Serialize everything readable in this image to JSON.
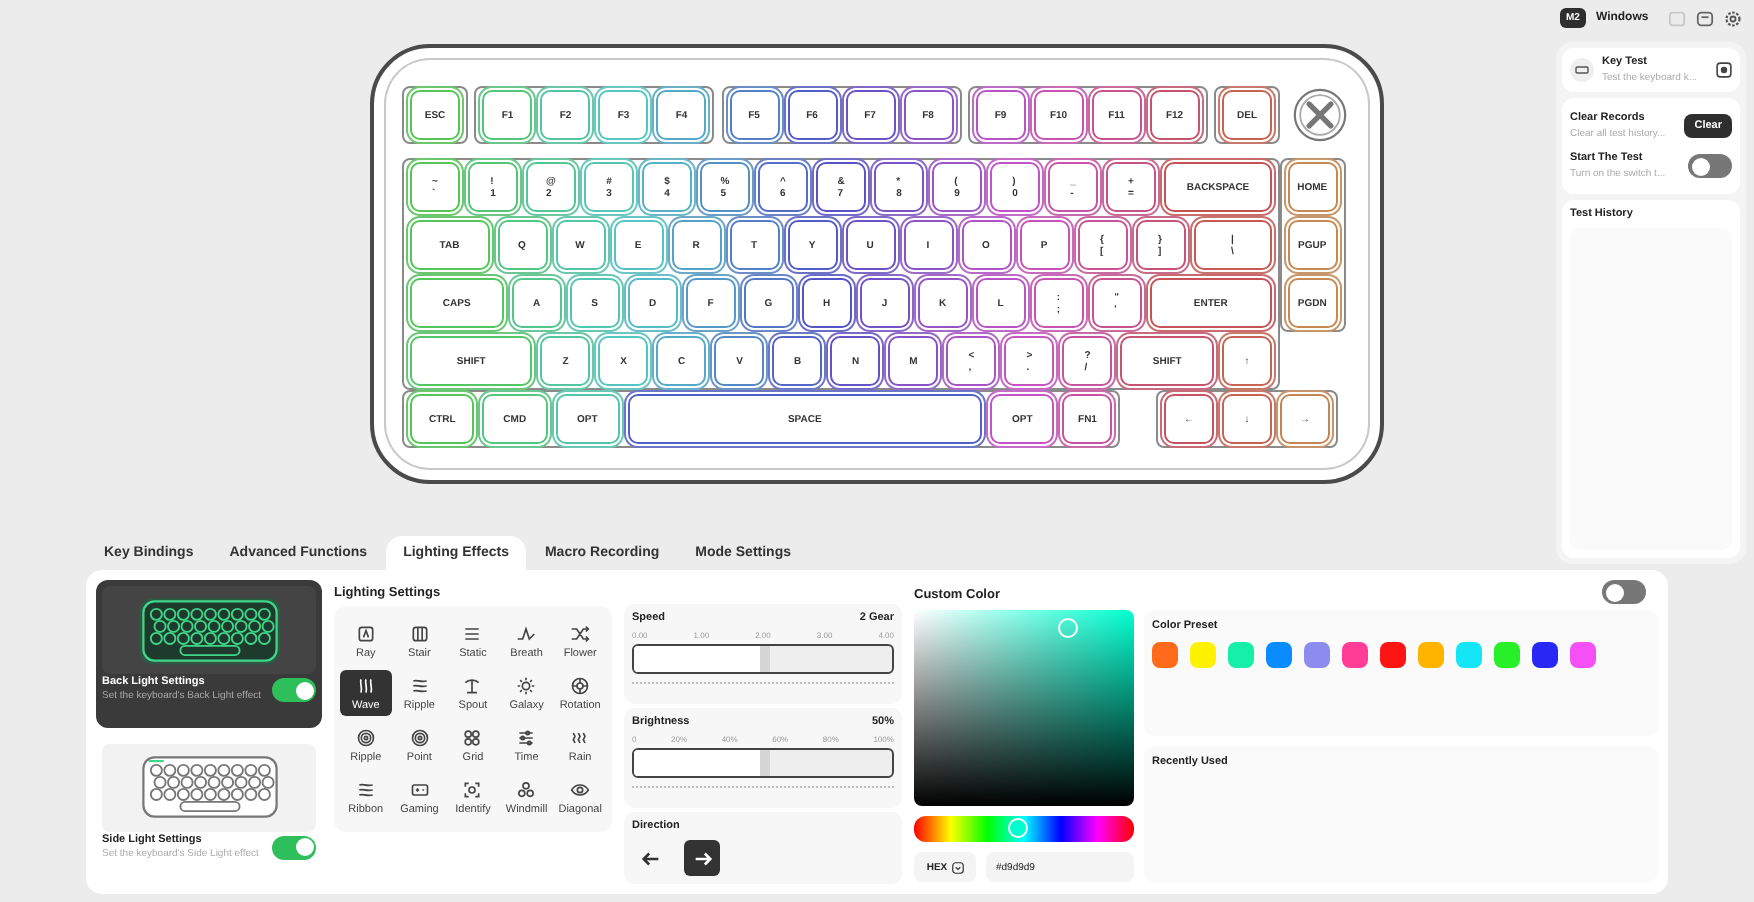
{
  "top_bar": {
    "profile": "M2",
    "os": "Windows"
  },
  "key_test": {
    "title": "Key Test",
    "description": "Test the keyboard k..."
  },
  "clear_records": {
    "title": "Clear Records",
    "description": "Clear all test history...",
    "button": "Clear"
  },
  "start_test": {
    "title": "Start The Test",
    "description": "Turn on the switch t...",
    "on": false
  },
  "test_history": {
    "title": "Test History"
  },
  "keyboard": {
    "rows": [
      [
        {
          "label": "ESC"
        },
        {
          "label": "F1"
        },
        {
          "label": "F2"
        },
        {
          "label": "F3"
        },
        {
          "label": "F4"
        },
        {
          "label": "F5"
        },
        {
          "label": "F6"
        },
        {
          "label": "F7"
        },
        {
          "label": "F8"
        },
        {
          "label": "F9"
        },
        {
          "label": "F10"
        },
        {
          "label": "F11"
        },
        {
          "label": "F12"
        },
        {
          "label": "DEL"
        }
      ],
      [
        {
          "label": "~",
          "sub": "`"
        },
        {
          "label": "!",
          "sub": "1"
        },
        {
          "label": "@",
          "sub": "2"
        },
        {
          "label": "#",
          "sub": "3"
        },
        {
          "label": "$",
          "sub": "4"
        },
        {
          "label": "%",
          "sub": "5"
        },
        {
          "label": "^",
          "sub": "6"
        },
        {
          "label": "&",
          "sub": "7"
        },
        {
          "label": "*",
          "sub": "8"
        },
        {
          "label": "(",
          "sub": "9"
        },
        {
          "label": ")",
          "sub": "0"
        },
        {
          "label": "_",
          "sub": "-"
        },
        {
          "label": "+",
          "sub": "="
        },
        {
          "label": "BACKSPACE"
        }
      ],
      [
        {
          "label": "TAB"
        },
        {
          "label": "Q"
        },
        {
          "label": "W"
        },
        {
          "label": "E"
        },
        {
          "label": "R"
        },
        {
          "label": "T"
        },
        {
          "label": "Y"
        },
        {
          "label": "U"
        },
        {
          "label": "I"
        },
        {
          "label": "O"
        },
        {
          "label": "P"
        },
        {
          "label": "{",
          "sub": "["
        },
        {
          "label": "}",
          "sub": "]"
        },
        {
          "label": "|",
          "sub": "\\"
        }
      ],
      [
        {
          "label": "CAPS"
        },
        {
          "label": "A"
        },
        {
          "label": "S"
        },
        {
          "label": "D"
        },
        {
          "label": "F"
        },
        {
          "label": "G"
        },
        {
          "label": "H"
        },
        {
          "label": "J"
        },
        {
          "label": "K"
        },
        {
          "label": "L"
        },
        {
          "label": ":",
          "sub": ";"
        },
        {
          "label": "\"",
          "sub": "'"
        },
        {
          "label": "ENTER"
        }
      ],
      [
        {
          "label": "SHIFT"
        },
        {
          "label": "Z"
        },
        {
          "label": "X"
        },
        {
          "label": "C"
        },
        {
          "label": "V"
        },
        {
          "label": "B"
        },
        {
          "label": "N"
        },
        {
          "label": "M"
        },
        {
          "label": "<",
          "sub": ","
        },
        {
          "label": ">",
          "sub": "."
        },
        {
          "label": "?",
          "sub": "/"
        },
        {
          "label": "SHIFT"
        }
      ],
      [
        {
          "label": "CTRL"
        },
        {
          "label": "CMD"
        },
        {
          "label": "OPT"
        },
        {
          "label": "SPACE"
        },
        {
          "label": "OPT"
        },
        {
          "label": "FN1"
        }
      ]
    ],
    "arrow_keys": [
      {
        "label": "↑"
      },
      {
        "label": "←"
      },
      {
        "label": "↓"
      },
      {
        "label": "→"
      }
    ],
    "nav_keys": [
      {
        "label": "HOME"
      },
      {
        "label": "PGUP"
      },
      {
        "label": "PGDN"
      }
    ]
  },
  "tabs": [
    {
      "label": "Key Bindings",
      "selected": false
    },
    {
      "label": "Advanced Functions",
      "selected": false
    },
    {
      "label": "Lighting Effects",
      "selected": true
    },
    {
      "label": "Macro Recording",
      "selected": false
    },
    {
      "label": "Mode Settings",
      "selected": false
    }
  ],
  "light_cards": [
    {
      "title": "Back Light Settings",
      "description": "Set the keyboard's Back Light effect",
      "selected": true,
      "on": true
    },
    {
      "title": "Side Light Settings",
      "description": "Set the keyboard's Side Light effect",
      "selected": false,
      "on": true
    }
  ],
  "lighting_settings": {
    "title": "Lighting Settings",
    "effects": [
      {
        "label": "Ray",
        "selected": false
      },
      {
        "label": "Stair",
        "selected": false
      },
      {
        "label": "Static",
        "selected": false
      },
      {
        "label": "Breath",
        "selected": false
      },
      {
        "label": "Flower",
        "selected": false
      },
      {
        "label": "Wave",
        "selected": true
      },
      {
        "label": "Ripple",
        "selected": false
      },
      {
        "label": "Spout",
        "selected": false
      },
      {
        "label": "Galaxy",
        "selected": false
      },
      {
        "label": "Rotation",
        "selected": false
      },
      {
        "label": "Ripple",
        "selected": false
      },
      {
        "label": "Point",
        "selected": false
      },
      {
        "label": "Grid",
        "selected": false
      },
      {
        "label": "Time",
        "selected": false
      },
      {
        "label": "Rain",
        "selected": false
      },
      {
        "label": "Ribbon",
        "selected": false
      },
      {
        "label": "Gaming",
        "selected": false
      },
      {
        "label": "Identify",
        "selected": false
      },
      {
        "label": "Windmill",
        "selected": false
      },
      {
        "label": "Diagonal",
        "selected": false
      }
    ]
  },
  "sliders": [
    {
      "label": "Speed",
      "reading": "2 Gear",
      "ticks": [
        "0.00",
        "1.00",
        "2.00",
        "3.00",
        "4.00"
      ],
      "level": 0.5
    },
    {
      "label": "Brightness",
      "reading": "50%",
      "ticks": [
        "0",
        "20%",
        "40%",
        "60%",
        "80%",
        "100%"
      ],
      "level": 0.5
    }
  ],
  "direction": {
    "label": "Direction",
    "options": [
      {
        "kind": "left",
        "selected": false
      },
      {
        "kind": "right",
        "selected": true
      }
    ]
  },
  "custom_color": {
    "title": "Custom Color",
    "on": false,
    "hue": {
      "level": 0.47
    },
    "format": "HEX",
    "hex": "#d9d9d9",
    "preset_title": "Color Preset",
    "presets": [
      {
        "color": "#ff6b1a"
      },
      {
        "color": "#fff200"
      },
      {
        "color": "#14f0a8"
      },
      {
        "color": "#0a8cff"
      },
      {
        "color": "#8c8cf0"
      },
      {
        "color": "#ff3c96"
      },
      {
        "color": "#ff1414"
      },
      {
        "color": "#ffb400"
      },
      {
        "color": "#14e6f5"
      },
      {
        "color": "#28f028"
      },
      {
        "color": "#2828f5"
      },
      {
        "color": "#f550f5"
      }
    ],
    "recent_title": "Recently Used"
  }
}
